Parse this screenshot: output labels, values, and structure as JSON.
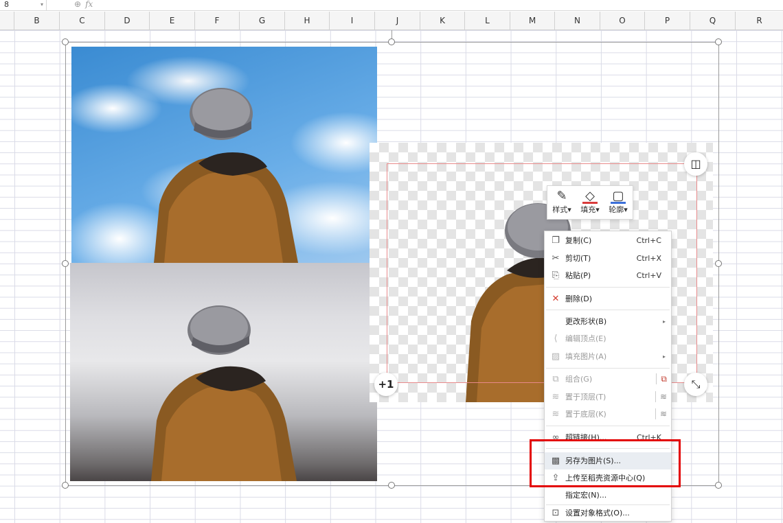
{
  "namebox": {
    "value": "8"
  },
  "formula_bar": {
    "fx_label": "fx"
  },
  "columns": [
    "B",
    "C",
    "D",
    "E",
    "F",
    "G",
    "H",
    "I",
    "J",
    "K",
    "L",
    "M",
    "N",
    "O",
    "P",
    "Q",
    "R"
  ],
  "float_toolbar": {
    "style_label": "样式",
    "fill_label": "填充",
    "outline_label": "轮廓"
  },
  "badge": {
    "plus_label": "+1"
  },
  "context_menu": {
    "items": [
      {
        "label": "复制(C)",
        "shortcut": "Ctrl+C",
        "icon": "copy-icon"
      },
      {
        "label": "剪切(T)",
        "shortcut": "Ctrl+X",
        "icon": "scissors-icon"
      },
      {
        "label": "粘贴(P)",
        "shortcut": "Ctrl+V",
        "icon": "paste-icon"
      },
      {
        "label": "删除(D)",
        "shortcut": "",
        "icon": "delete-icon"
      },
      {
        "label": "更改形状(B)",
        "shortcut": "",
        "icon": ""
      },
      {
        "label": "编辑顶点(E)",
        "shortcut": "",
        "icon": "edit-points-icon"
      },
      {
        "label": "填充图片(A)",
        "shortcut": "",
        "icon": "fill-picture-icon"
      },
      {
        "label": "组合(G)",
        "shortcut": "",
        "icon": "group-icon"
      },
      {
        "label": "置于顶层(T)",
        "shortcut": "",
        "icon": "bring-front-icon"
      },
      {
        "label": "置于底层(K)",
        "shortcut": "",
        "icon": "send-back-icon"
      },
      {
        "label": "超链接(H)...",
        "shortcut": "Ctrl+K",
        "icon": "link-icon"
      },
      {
        "label": "另存为图片(S)...",
        "shortcut": "",
        "icon": "save-image-icon"
      },
      {
        "label": "上传至稻壳资源中心(Q)",
        "shortcut": "",
        "icon": "upload-icon"
      },
      {
        "label": "指定宏(N)...",
        "shortcut": "",
        "icon": ""
      },
      {
        "label": "设置对象格式(O)...",
        "shortcut": "",
        "icon": "format-object-icon"
      }
    ]
  },
  "colors": {
    "accent_red": "#e30000",
    "selection_pink": "#e8898a",
    "menu_highlight": "#e9edf2"
  }
}
